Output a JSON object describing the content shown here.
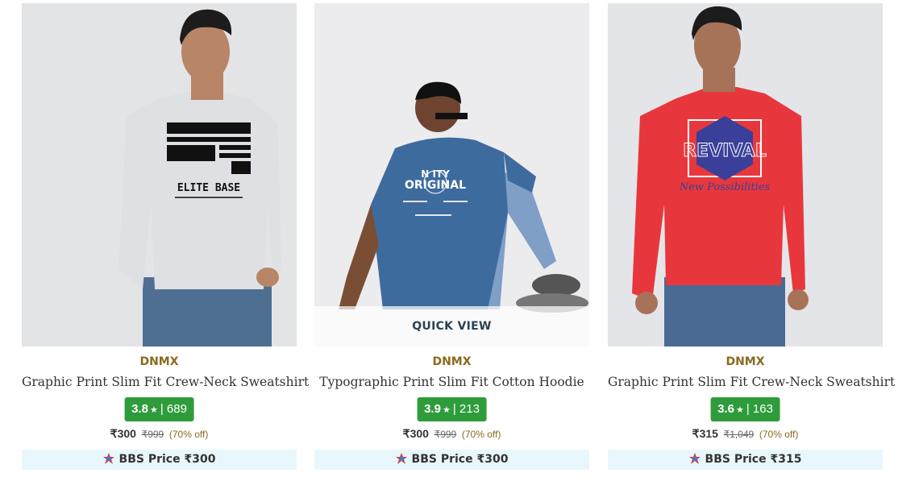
{
  "products": [
    {
      "brand": "DNMX",
      "name": "Graphic Print Slim Fit Crew-Neck Sweatshirt",
      "rating": "3.8",
      "reviews": "689",
      "price": "₹300",
      "mrp": "₹999",
      "discount": "(70% off)",
      "bbs_label": "BBS Price ₹300",
      "print_text": "ELITE BASE",
      "shirt_color": "#dfe0e3"
    },
    {
      "brand": "DNMX",
      "name": "Typographic Print Slim Fit Cotton Hoodie",
      "rating": "3.9",
      "reviews": "213",
      "price": "₹300",
      "mrp": "₹999",
      "discount": "(70% off)",
      "bbs_label": "BBS Price ₹300",
      "print_text": "ORIGINAL",
      "quick_view": "QUICK VIEW",
      "shirt_color": "#3e6b9e"
    },
    {
      "brand": "DNMX",
      "name": "Graphic Print Slim Fit Crew-Neck Sweatshirt",
      "rating": "3.6",
      "reviews": "163",
      "price": "₹315",
      "mrp": "₹1,049",
      "discount": "(70% off)",
      "bbs_label": "BBS Price ₹315",
      "print_text": "New Possibilities",
      "shirt_color": "#e8373c"
    }
  ],
  "colors": {
    "rating_bg": "#2e9c3b",
    "brand": "#8b6a1f",
    "bbs_bg": "#e8f7fc"
  },
  "icons": {
    "star": "star-icon",
    "bbs": "bbs-badge-icon"
  }
}
